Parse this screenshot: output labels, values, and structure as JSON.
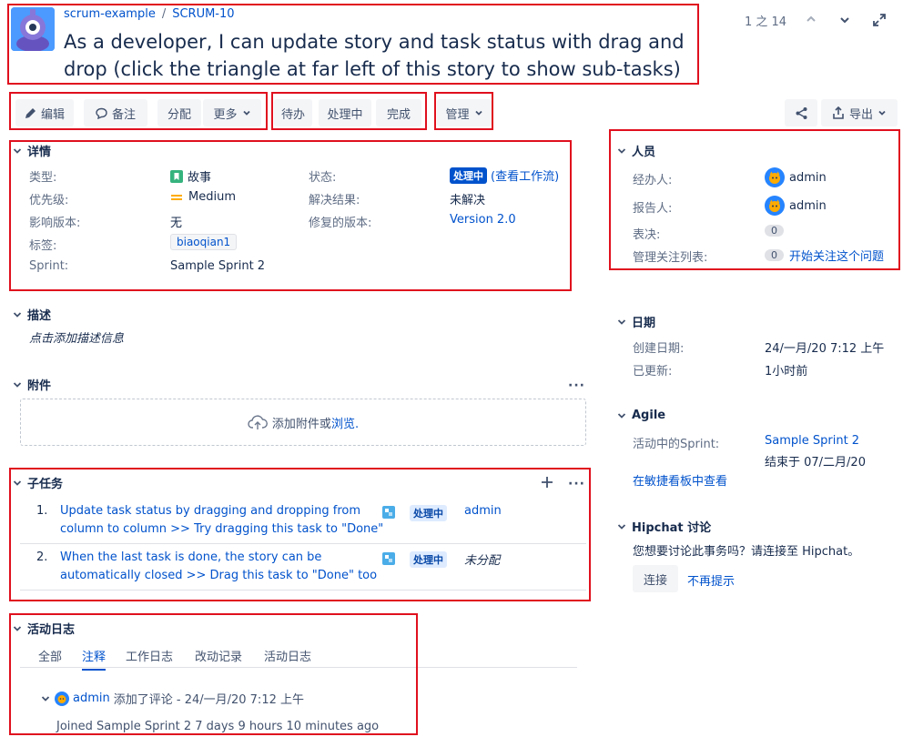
{
  "breadcrumb": {
    "project": "scrum-example",
    "separator": "/",
    "issue_key": "SCRUM-10"
  },
  "title": "As a developer, I can update story and task status with drag and drop (click the triangle at far left of this story to show sub-tasks)",
  "pager": {
    "text": "1 之 14"
  },
  "toolbar": {
    "edit": "编辑",
    "comment": "备注",
    "assign": "分配",
    "more": "更多",
    "todo": "待办",
    "in_progress": "处理中",
    "done": "完成",
    "admin": "管理",
    "export": "导出"
  },
  "details": {
    "title": "详情",
    "type_label": "类型:",
    "type_value": "故事",
    "priority_label": "优先级:",
    "priority_value": "Medium",
    "affects_label": "影响版本:",
    "affects_value": "无",
    "labels_label": "标签:",
    "labels_value": "biaoqian1",
    "sprint_label": "Sprint:",
    "sprint_value": "Sample Sprint 2",
    "status_label": "状态:",
    "status_value": "处理中",
    "workflow_link": "(查看工作流)",
    "resolution_label": "解决结果:",
    "resolution_value": "未解决",
    "fix_label": "修复的版本:",
    "fix_value": "Version 2.0"
  },
  "description": {
    "title": "描述",
    "placeholder": "点击添加描述信息"
  },
  "attachments": {
    "title": "附件",
    "drop_text": "添加附件或",
    "browse": "浏览."
  },
  "subtasks": {
    "title": "子任务",
    "items": [
      {
        "num": "1.",
        "line1": "Update task status by dragging and dropping from",
        "line2": "column to column >> Try dragging this task to \"Done\"",
        "status": "处理中",
        "assignee": "admin"
      },
      {
        "num": "2.",
        "line1": "When the last task is done, the story can be",
        "line2": "automatically closed >> Drag this task to \"Done\" too",
        "status": "处理中",
        "assignee": "未分配"
      }
    ]
  },
  "activity": {
    "title": "活动日志",
    "tabs": [
      "全部",
      "注释",
      "工作日志",
      "改动记录",
      "活动日志"
    ],
    "comment_author": "admin",
    "comment_meta": "添加了评论 - 24/一月/20 7:12 上午",
    "comment_body": "Joined Sample Sprint 2 7 days 9 hours 10 minutes ago"
  },
  "people": {
    "title": "人员",
    "assignee_label": "经办人:",
    "assignee_value": "admin",
    "reporter_label": "报告人:",
    "reporter_value": "admin",
    "votes_label": "表决:",
    "votes_value": "0",
    "watchers_label": "管理关注列表:",
    "watchers_value": "0",
    "watch_link": "开始关注这个问题"
  },
  "dates": {
    "title": "日期",
    "created_label": "创建日期:",
    "created_value": "24/一月/20 7:12 上午",
    "updated_label": "已更新:",
    "updated_value": "1小时前"
  },
  "agile": {
    "title": "Agile",
    "active_label": "活动中的Sprint:",
    "sprint_link": "Sample Sprint 2",
    "ends": "结束于 07/二月/20",
    "board_link": "在敏捷看板中查看"
  },
  "hipchat": {
    "title": "Hipchat 讨论",
    "text": "您想要讨论此事务吗？请连接至 Hipchat。",
    "connect": "连接",
    "dismiss": "不再提示"
  },
  "colors": {
    "accent": "#0052cc",
    "highlight": "#e0101e",
    "story": "#36b37e",
    "priority": "#ffab00"
  }
}
